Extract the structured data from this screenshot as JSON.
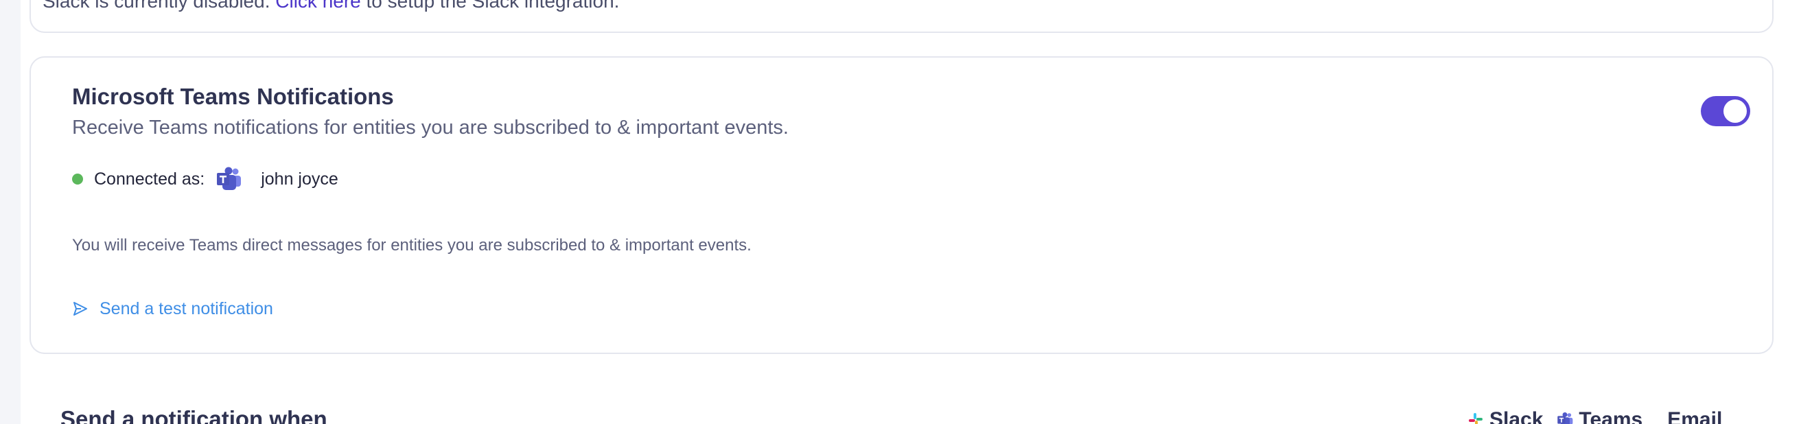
{
  "slack": {
    "text_before": "Slack is currently disabled. ",
    "link": "Click here",
    "text_after": " to setup the Slack integration."
  },
  "teams": {
    "title": "Microsoft Teams Notifications",
    "subtitle": "Receive Teams notifications for entities you are subscribed to & important events.",
    "toggle_on": true,
    "connected_label": "Connected as:",
    "user_name": "john joyce",
    "info": "You will receive Teams direct messages for entities you are subscribed to & important events.",
    "test_link": "Send a test notification"
  },
  "notify": {
    "heading": "Send a notification when",
    "columns": {
      "slack": "Slack",
      "teams": "Teams",
      "email": "Email"
    }
  },
  "colors": {
    "accent": "#5b47d6",
    "link": "#3f8ee6",
    "status_connected": "#5cb85c"
  },
  "icons": {
    "status": "status-dot-icon",
    "teams": "teams-logo-icon",
    "send": "send-icon",
    "slack": "slack-logo-icon"
  }
}
